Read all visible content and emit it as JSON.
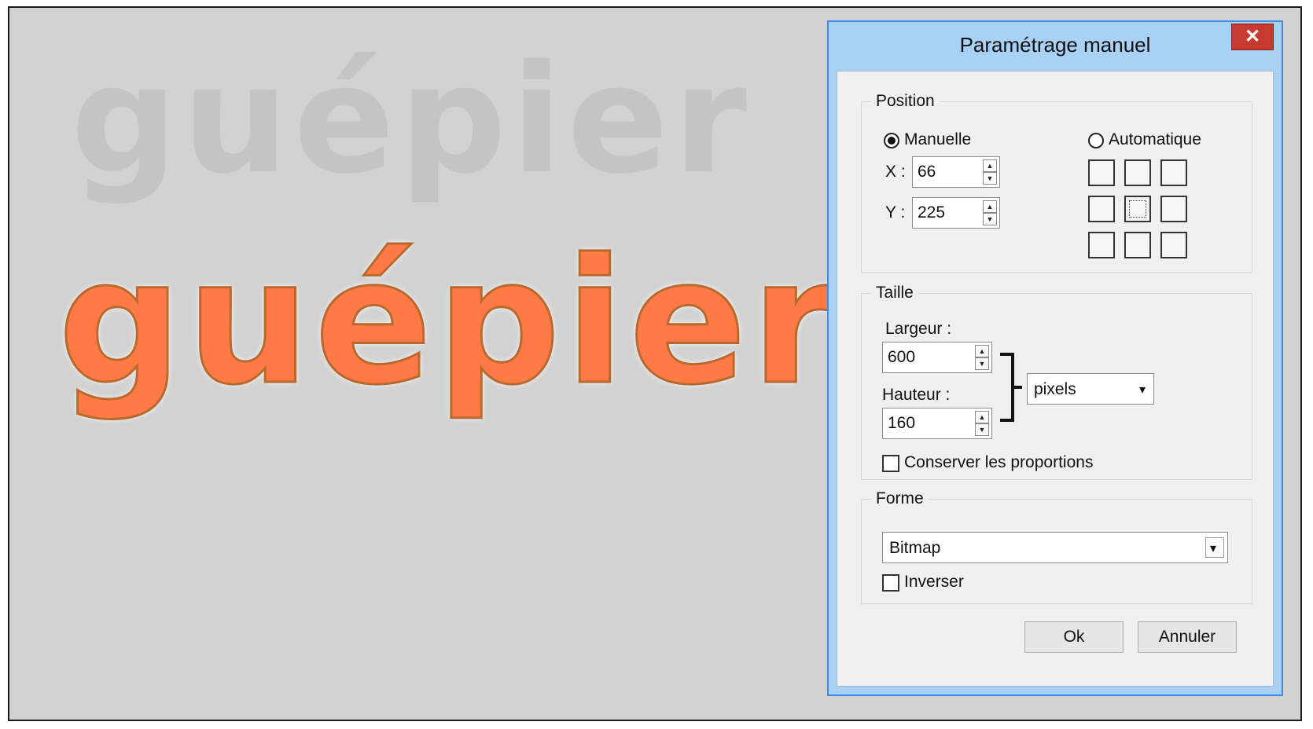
{
  "canvas": {
    "ghost_text": "guépier",
    "selected_text": "guépier"
  },
  "dialog": {
    "title": "Paramétrage manuel",
    "close_glyph": "✕",
    "position": {
      "legend": "Position",
      "manual_label": "Manuelle",
      "auto_label": "Automatique",
      "x_label": "X :",
      "y_label": "Y :",
      "x_value": "66",
      "y_value": "225",
      "selected_mode": "Manuelle",
      "anchor_grid_selected": "center"
    },
    "taille": {
      "legend": "Taille",
      "width_label": "Largeur :",
      "height_label": "Hauteur :",
      "width_value": "600",
      "height_value": "160",
      "unit_value": "pixels",
      "keep_proportions_label": "Conserver les proportions",
      "keep_proportions_checked": false
    },
    "forme": {
      "legend": "Forme",
      "shape_value": "Bitmap",
      "invert_label": "Inverser",
      "invert_checked": false
    },
    "buttons": {
      "ok_label": "Ok",
      "cancel_label": "Annuler"
    }
  },
  "colors": {
    "selection_fill": "#ff7a45",
    "ghost_text": "#c4c4c4",
    "canvas_bg": "#d2d2d2",
    "dialog_frame": "#a9d0f5",
    "close_button": "#c73a32"
  },
  "icons": {
    "spin_up": "▲",
    "spin_down": "▼",
    "dropdown": "▾"
  }
}
